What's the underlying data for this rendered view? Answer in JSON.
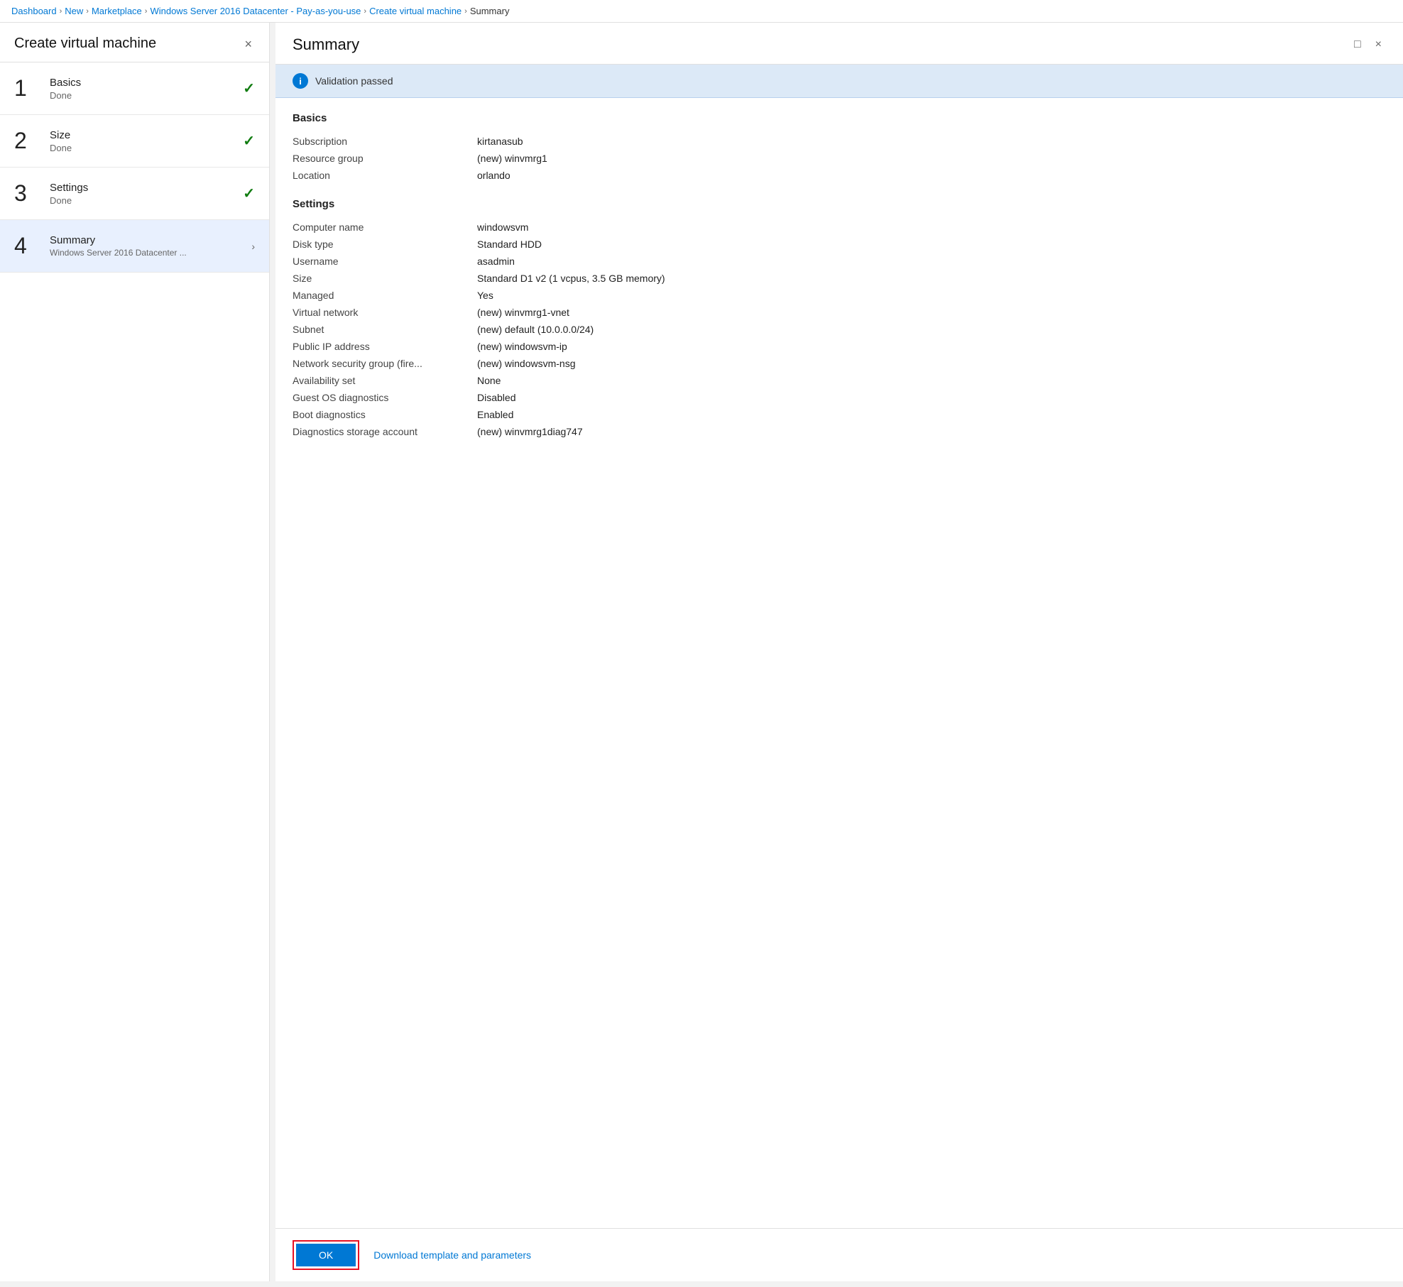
{
  "breadcrumb": {
    "items": [
      {
        "label": "Dashboard",
        "active": false
      },
      {
        "label": "New",
        "active": false
      },
      {
        "label": "Marketplace",
        "active": false
      },
      {
        "label": "Windows Server 2016 Datacenter - Pay-as-you-use",
        "active": false
      },
      {
        "label": "Create virtual machine",
        "active": false
      },
      {
        "label": "Summary",
        "active": true
      }
    ]
  },
  "left_panel": {
    "title": "Create virtual machine",
    "close_label": "×",
    "steps": [
      {
        "number": "1",
        "name": "Basics",
        "status": "Done",
        "check": true,
        "active": false,
        "sub": null
      },
      {
        "number": "2",
        "name": "Size",
        "status": "Done",
        "check": true,
        "active": false,
        "sub": null
      },
      {
        "number": "3",
        "name": "Settings",
        "status": "Done",
        "check": true,
        "active": false,
        "sub": null
      },
      {
        "number": "4",
        "name": "Summary",
        "status": "",
        "check": false,
        "active": true,
        "sub": "Windows Server 2016 Datacenter ..."
      }
    ]
  },
  "right_panel": {
    "title": "Summary",
    "validation_text": "Validation passed",
    "basics_section_label": "Basics",
    "basics_rows": [
      {
        "label": "Subscription",
        "value": "kirtanasub"
      },
      {
        "label": "Resource group",
        "value": "(new) winvmrg1"
      },
      {
        "label": "Location",
        "value": "orlando"
      }
    ],
    "settings_section_label": "Settings",
    "settings_rows": [
      {
        "label": "Computer name",
        "value": "windowsvm"
      },
      {
        "label": "Disk type",
        "value": "Standard HDD"
      },
      {
        "label": "Username",
        "value": "asadmin"
      },
      {
        "label": "Size",
        "value": "Standard D1 v2 (1 vcpus, 3.5 GB memory)"
      },
      {
        "label": "Managed",
        "value": "Yes"
      },
      {
        "label": "Virtual network",
        "value": "(new) winvmrg1-vnet"
      },
      {
        "label": "Subnet",
        "value": "(new) default (10.0.0.0/24)"
      },
      {
        "label": "Public IP address",
        "value": "(new) windowsvm-ip"
      },
      {
        "label": "Network security group (fire...",
        "value": "(new) windowsvm-nsg"
      },
      {
        "label": "Availability set",
        "value": "None"
      },
      {
        "label": "Guest OS diagnostics",
        "value": "Disabled"
      },
      {
        "label": "Boot diagnostics",
        "value": "Enabled"
      },
      {
        "label": "Diagnostics storage account",
        "value": "(new) winvmrg1diag747"
      }
    ],
    "ok_button_label": "OK",
    "download_link_label": "Download template and parameters"
  },
  "icons": {
    "close": "×",
    "check": "✓",
    "chevron": "›",
    "minimize": "□",
    "info": "i"
  }
}
